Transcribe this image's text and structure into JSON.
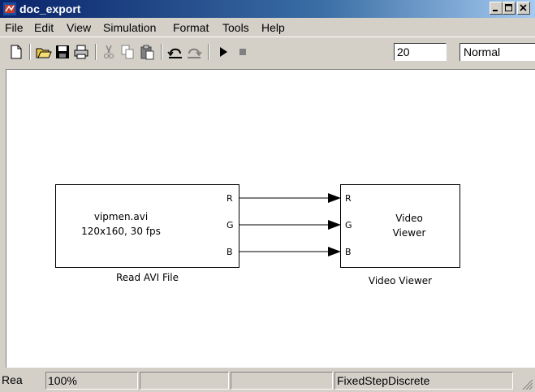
{
  "window": {
    "title": "doc_export"
  },
  "menu": [
    "File",
    "Edit",
    "View",
    "Simulation",
    "Format",
    "Tools",
    "Help"
  ],
  "toolbar": {
    "stop_time": "20",
    "sim_mode": "Normal"
  },
  "blocks": {
    "read_avi": {
      "line1": "vipmen.avi",
      "line2": "120x160, 30 fps",
      "name": "Read AVI File",
      "ports": [
        "R",
        "G",
        "B"
      ]
    },
    "video_viewer": {
      "line1": "Video",
      "line2": "Viewer",
      "name": "Video Viewer",
      "ports": [
        "R",
        "G",
        "B"
      ]
    }
  },
  "status": {
    "ready": "Rea",
    "zoom": "100%",
    "solver": "FixedStepDiscrete"
  }
}
